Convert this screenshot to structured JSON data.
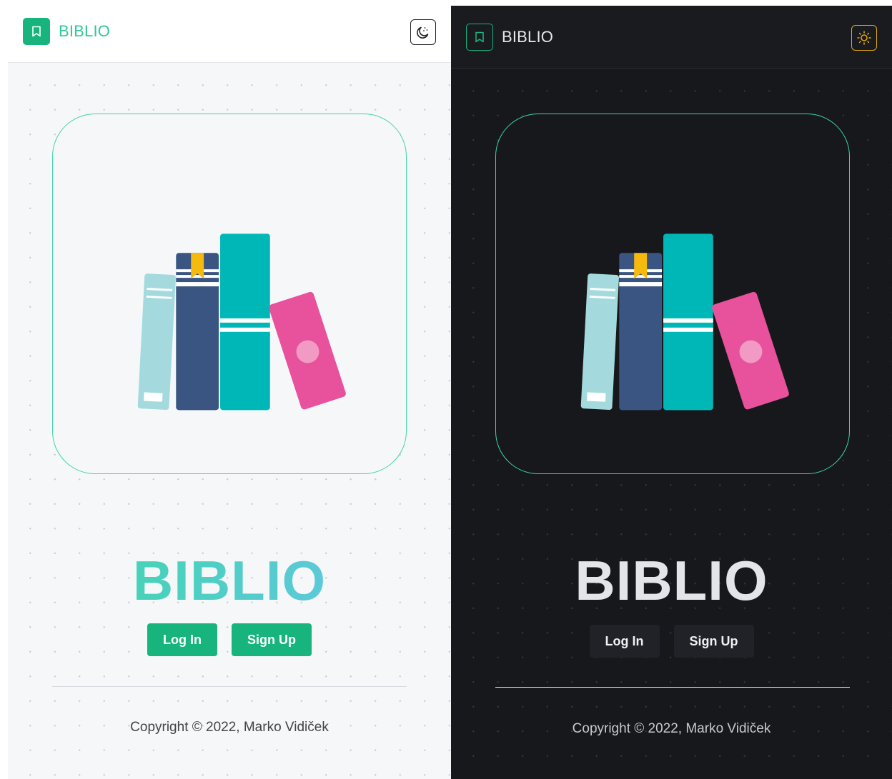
{
  "light": {
    "header": {
      "brand": "BIBLIO",
      "logo_icon": "bookmark-icon",
      "theme_toggle_icon": "moon-icon"
    },
    "hero": {
      "title": "BIBLIO"
    },
    "buttons": {
      "login": "Log In",
      "signup": "Sign Up"
    },
    "footer": {
      "copyright": "Copyright © 2022, Marko Vidiček"
    }
  },
  "dark": {
    "header": {
      "brand": "BIBLIO",
      "logo_icon": "bookmark-icon",
      "theme_toggle_icon": "sun-icon"
    },
    "hero": {
      "title": "BIBLIO"
    },
    "buttons": {
      "login": "Log In",
      "signup": "Sign Up"
    },
    "footer": {
      "copyright": "Copyright © 2022, Marko Vidiček"
    }
  },
  "colors": {
    "accent": "#17b47e",
    "accent_border": "#3fd6a2",
    "sun": "#e2a714",
    "book_light_blue": "#a4dade",
    "book_navy": "#3a5582",
    "book_teal": "#00b7b7",
    "book_pink": "#e8519b",
    "bookmark_yellow": "#f6b90e"
  }
}
